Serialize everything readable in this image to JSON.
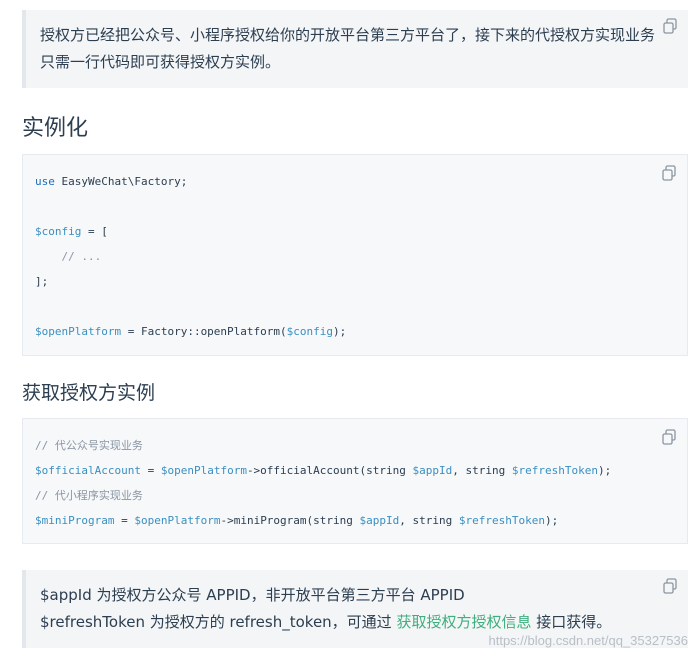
{
  "intro_note": {
    "text": "授权方已经把公众号、小程序授权给你的开放平台第三方平台了，接下来的代授权方实现业务只需一行代码即可获得授权方实例。"
  },
  "section_instantiate": {
    "title": "实例化",
    "code_lines": {
      "l1_kw": "use",
      "l1_rest": " EasyWeChat\\Factory;",
      "l3_var": "$config",
      "l3_rest": " = [",
      "l4_comment": "    // ...",
      "l5": "];",
      "l7_var": "$openPlatform",
      "l7_mid": " = Factory::openPlatform(",
      "l7_arg": "$config",
      "l7_end": ");"
    }
  },
  "section_get_instance": {
    "title": "获取授权方实例",
    "code_lines": {
      "c1": "// 代公众号实现业务",
      "v1a": "$officialAccount",
      "v1b": " = ",
      "v1c": "$openPlatform",
      "v1d": "->officialAccount(string ",
      "v1e": "$appId",
      "v1f": ", string ",
      "v1g": "$refreshToken",
      "v1h": ");",
      "c2": "// 代小程序实现业务",
      "v2a": "$miniProgram",
      "v2b": " = ",
      "v2c": "$openPlatform",
      "v2d": "->miniProgram(string ",
      "v2e": "$appId",
      "v2f": ", string ",
      "v2g": "$refreshToken",
      "v2h": ");"
    }
  },
  "params_note": {
    "line1": "$appId 为授权方公众号 APPID，非开放平台第三方平台 APPID",
    "line2_prefix": "$refreshToken 为授权方的 refresh_token，可通过 ",
    "line2_link": "获取授权方授权信息",
    "line2_suffix": " 接口获得。"
  },
  "watermark": "https://blog.csdn.net/qq_35327536",
  "icons": {
    "copy": "copy-icon"
  }
}
